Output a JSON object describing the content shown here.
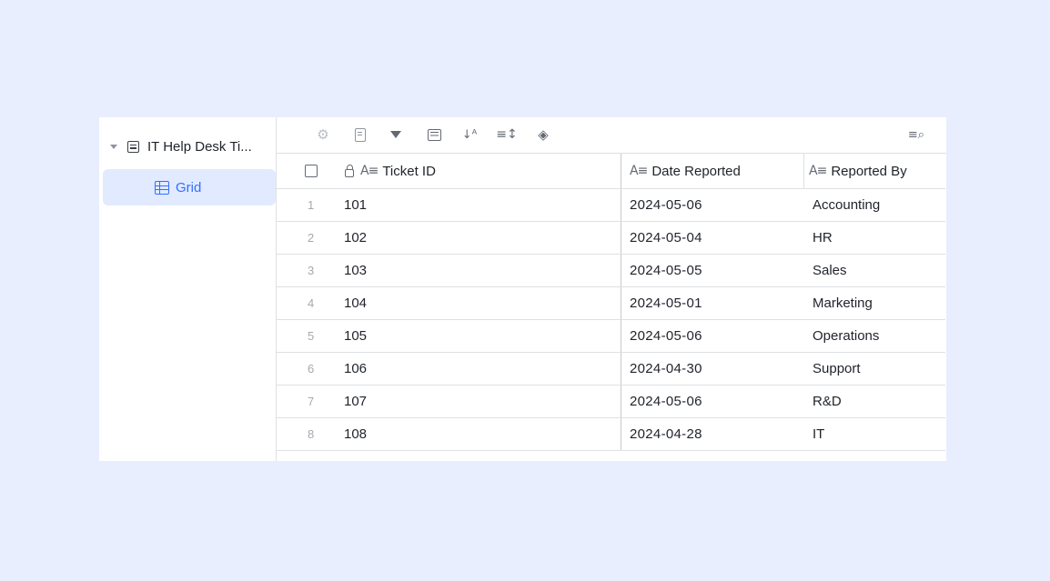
{
  "sidebar": {
    "table_name": "IT Help Desk Ti...",
    "views": [
      {
        "label": "Grid"
      }
    ]
  },
  "toolbar": {
    "icons": [
      "settings-icon",
      "form-icon",
      "filter-icon",
      "group-icon",
      "sort-icon",
      "row-height-icon",
      "fill-color-icon",
      "search-icon"
    ]
  },
  "table": {
    "columns": [
      {
        "label": "Ticket ID",
        "icon": "text-field-icon",
        "locked": true
      },
      {
        "label": "Date Reported",
        "icon": "text-field-icon"
      },
      {
        "label": "Reported By",
        "icon": "text-field-icon"
      }
    ],
    "rows": [
      {
        "num": "1",
        "id": "101",
        "date": "2024-05-06",
        "by": "Accounting"
      },
      {
        "num": "2",
        "id": "102",
        "date": "2024-05-04",
        "by": "HR"
      },
      {
        "num": "3",
        "id": "103",
        "date": "2024-05-05",
        "by": "Sales"
      },
      {
        "num": "4",
        "id": "104",
        "date": "2024-05-01",
        "by": "Marketing"
      },
      {
        "num": "5",
        "id": "105",
        "date": "2024-05-06",
        "by": "Operations"
      },
      {
        "num": "6",
        "id": "106",
        "date": "2024-04-30",
        "by": "Support"
      },
      {
        "num": "7",
        "id": "107",
        "date": "2024-05-06",
        "by": "R&D"
      },
      {
        "num": "8",
        "id": "108",
        "date": "2024-04-28",
        "by": "IT"
      }
    ]
  }
}
